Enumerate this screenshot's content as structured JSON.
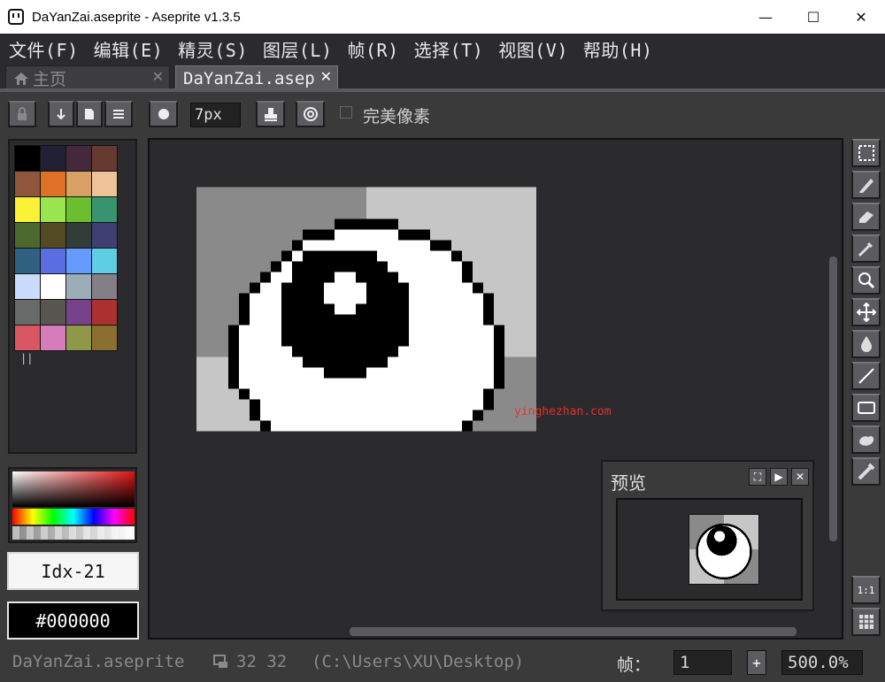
{
  "window": {
    "title": "DaYanZai.aseprite - Aseprite v1.3.5",
    "minimize": "—",
    "maximize": "☐",
    "close": "✕"
  },
  "menu": [
    "文件(F)",
    "编辑(E)",
    "精灵(S)",
    "图层(L)",
    "帧(R)",
    "选择(T)",
    "视图(V)",
    "帮助(H)"
  ],
  "tabs": {
    "home": {
      "label": "主页",
      "close": "✕"
    },
    "doc": {
      "label": "DaYanZai.aseprite",
      "close": "✕"
    }
  },
  "context": {
    "brush_size": "7px",
    "pixel_perfect_label": "完美像素",
    "pixel_perfect_checked": false
  },
  "palette": {
    "colors": [
      "#000000",
      "#222034",
      "#45283c",
      "#663931",
      "#8f563b",
      "#df7126",
      "#d9a066",
      "#eec39a",
      "#fbf236",
      "#99e550",
      "#6abe30",
      "#37946e",
      "#4b692f",
      "#524b24",
      "#323c39",
      "#3f3f74",
      "#306082",
      "#5b6ee1",
      "#639bff",
      "#5fcde4",
      "#cbdbfc",
      "#ffffff",
      "#9badb7",
      "#847e87",
      "#696a6a",
      "#595652",
      "#76428a",
      "#ac3232",
      "#d95763",
      "#d77bba",
      "#8f974a",
      "#8a6f30"
    ],
    "selected_index": 21
  },
  "color_index": "Idx-21",
  "color_hex": "#000000",
  "preview": {
    "title": "预览"
  },
  "watermark": "yinghezhan.com",
  "status": {
    "filename": "DaYanZai.aseprite",
    "size": "32 32",
    "path": "(C:\\Users\\XU\\Desktop)",
    "frame_label": "帧：",
    "frame_value": "1",
    "add_frame": "+",
    "zoom": "500.0%"
  },
  "tools": [
    "rectangular-marquee",
    "pencil",
    "eraser",
    "eyedropper",
    "zoom",
    "move",
    "paint-bucket",
    "line",
    "rectangle",
    "contour",
    "blur"
  ],
  "bottom_tools": {
    "one_to_one": "1:1"
  },
  "colors": {
    "bg": "#3a3a3a",
    "panel": "#2b2a2d",
    "button": "#5c5b60"
  }
}
